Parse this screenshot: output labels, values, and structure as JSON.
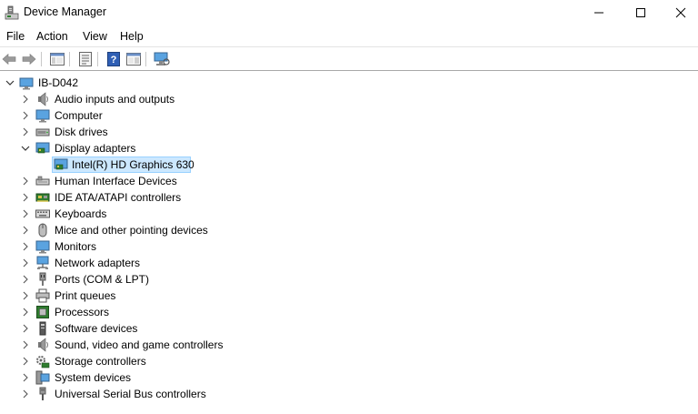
{
  "window": {
    "title": "Device Manager"
  },
  "menu": {
    "file": "File",
    "action": "Action",
    "view": "View",
    "help": "Help"
  },
  "tree": {
    "root": "IB-D042",
    "categories": [
      {
        "label": "Audio inputs and outputs",
        "icon": "speaker-icon"
      },
      {
        "label": "Computer",
        "icon": "computer-icon"
      },
      {
        "label": "Disk drives",
        "icon": "disk-drive-icon"
      },
      {
        "label": "Display adapters",
        "icon": "display-adapter-icon",
        "expanded": true
      },
      {
        "label": "Human Interface Devices",
        "icon": "hid-icon"
      },
      {
        "label": "IDE ATA/ATAPI controllers",
        "icon": "ide-controller-icon"
      },
      {
        "label": "Keyboards",
        "icon": "keyboard-icon"
      },
      {
        "label": "Mice and other pointing devices",
        "icon": "mouse-icon"
      },
      {
        "label": "Monitors",
        "icon": "monitor-icon"
      },
      {
        "label": "Network adapters",
        "icon": "network-adapter-icon"
      },
      {
        "label": "Ports (COM & LPT)",
        "icon": "port-icon"
      },
      {
        "label": "Print queues",
        "icon": "printer-icon"
      },
      {
        "label": "Processors",
        "icon": "processor-icon"
      },
      {
        "label": "Software devices",
        "icon": "software-device-icon"
      },
      {
        "label": "Sound, video and game controllers",
        "icon": "sound-controller-icon"
      },
      {
        "label": "Storage controllers",
        "icon": "storage-controller-icon"
      },
      {
        "label": "System devices",
        "icon": "system-device-icon"
      },
      {
        "label": "Universal Serial Bus controllers",
        "icon": "usb-icon"
      }
    ],
    "display_children": [
      {
        "label": "Intel(R) HD Graphics 630",
        "icon": "display-adapter-icon",
        "selected": true
      }
    ]
  },
  "colors": {
    "selection_bg": "#cce8ff",
    "selection_border": "#99d1ff"
  }
}
